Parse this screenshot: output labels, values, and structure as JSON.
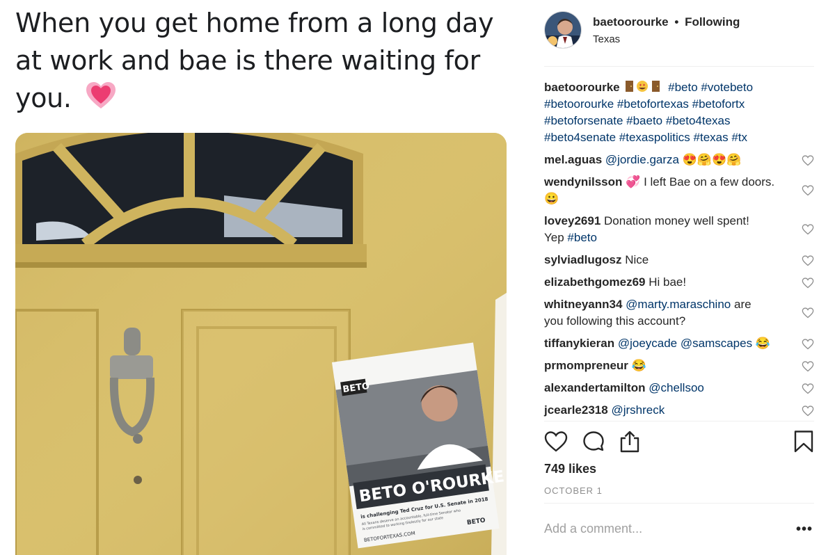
{
  "post": {
    "caption_lines": [
      "When you get home from a long day",
      "at work and bae is there waiting for",
      "you."
    ],
    "caption_emoji": "heart-emoji",
    "flyer": {
      "logo": "BETO",
      "logo_sub": "FOR SENATE",
      "name": "BETO O'ROURKE",
      "tagline": "is challenging Ted Cruz for U.S. Senate in 2018",
      "body_1": "All Texans deserve an accountable, full-time Senator who",
      "body_2": "is committed to working tirelessly for our state",
      "website": "BETOFORTEXAS.COM",
      "footer_logo": "BETO"
    }
  },
  "header": {
    "username": "baetoorourke",
    "separator": "•",
    "follow_status": "Following",
    "location": "Texas"
  },
  "owner_comment": {
    "user": "baetoorourke",
    "emojis": "door-emoji smiling-heart-eyes-emoji door-emoji",
    "hashtags_1": "#beto #votebeto",
    "hashtags_2": "#betoorourke #betofortexas #betofortx",
    "hashtags_3": "#betoforsenate #baeto #beto4texas",
    "hashtags_4": "#beto4senate #texaspolitics #texas #tx"
  },
  "comments": [
    {
      "user": "mel.aguas",
      "mention": "@jordie.garza",
      "text": "",
      "emoji": "😍🤗😍🤗"
    },
    {
      "user": "wendynilsson",
      "pre_emoji": "💞",
      "text": "I left Bae on a few doors.",
      "emoji": "😀"
    },
    {
      "user": "lovey2691",
      "text": "Donation money well spent!",
      "text2": "Yep",
      "hashtag": "#beto"
    },
    {
      "user": "sylviadlugosz",
      "text": "Nice"
    },
    {
      "user": "elizabethgomez69",
      "text": "Hi bae!"
    },
    {
      "user": "whitneyann34",
      "mention": "@marty.maraschino",
      "text": "are",
      "text2": "you following this account?"
    },
    {
      "user": "tiffanykieran",
      "mention": "@joeycade @samscapes",
      "emoji": "😂"
    },
    {
      "user": "prmompreneur",
      "emoji": "😂"
    },
    {
      "user": "alexandertamilton",
      "mention": "@chellsoo"
    },
    {
      "user": "jcearle2318",
      "mention": "@jrshreck"
    }
  ],
  "footer": {
    "likes": "749 likes",
    "date": "OCTOBER 1",
    "add_comment_placeholder": "Add a comment...",
    "more": "•••"
  },
  "icons": {
    "like": "heart-outline-icon",
    "comment": "speech-bubble-icon",
    "share": "share-icon",
    "save": "bookmark-icon"
  }
}
